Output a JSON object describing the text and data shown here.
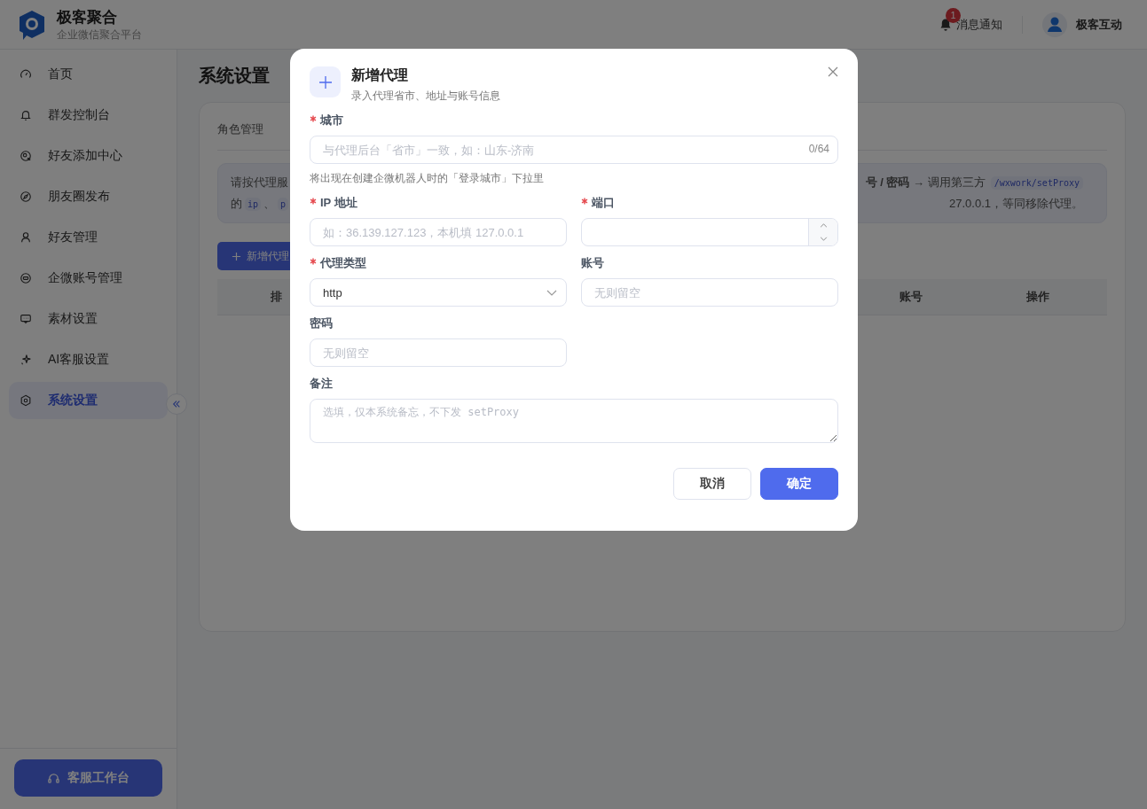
{
  "app": {
    "name": "极客聚合",
    "subtitle": "企业微信聚合平台"
  },
  "header": {
    "notification": {
      "label": "消息通知",
      "badge": "1"
    },
    "user": {
      "name": "极客互动"
    }
  },
  "sidebar": {
    "items": [
      {
        "label": "首页",
        "selected": false
      },
      {
        "label": "群发控制台",
        "selected": false
      },
      {
        "label": "好友添加中心",
        "selected": false
      },
      {
        "label": "朋友圈发布",
        "selected": false
      },
      {
        "label": "好友管理",
        "selected": false
      },
      {
        "label": "企微账号管理",
        "selected": false
      },
      {
        "label": "素材设置",
        "selected": false
      },
      {
        "label": "AI客服设置",
        "selected": false
      },
      {
        "label": "系统设置",
        "selected": true
      }
    ],
    "footer_button": "客服工作台"
  },
  "page": {
    "title": "系统设置",
    "tab": "角色管理",
    "notice": {
      "line_1_left": "请按代理服",
      "line_1_right": "**号 / 密码** → 调用第三方",
      "line_1_code": "/wxwork/setProxy",
      "line_2_left": "的",
      "line_2_codes": [
        "ip",
        "p"
      ],
      "line_2_separator": "、",
      "line_2_right": "27.0.0.1，等同移除代理。"
    },
    "add_button": "新增代理",
    "table": {
      "columns": [
        "排",
        "账号",
        "操作"
      ]
    }
  },
  "dialog": {
    "title": "新增代理",
    "subtitle": "录入代理省市、地址与账号信息",
    "rows": [
      [
        {
          "label": "城市",
          "required": true,
          "kind": "text",
          "placeholder": "与代理后台「省市」一致，如：山东-济南",
          "counter": "0/64",
          "hint": "将出现在创建企微机器人时的「登录城市」下拉里"
        }
      ],
      [
        {
          "label": "IP 地址",
          "required": true,
          "kind": "text",
          "placeholder": "如：36.139.127.123，本机填 127.0.0.1"
        },
        {
          "label": "端口",
          "required": true,
          "kind": "number"
        }
      ],
      [
        {
          "label": "代理类型",
          "required": true,
          "kind": "select",
          "value": "http"
        },
        {
          "label": "账号",
          "required": false,
          "kind": "text",
          "placeholder": "无则留空"
        }
      ],
      [
        {
          "label": "密码",
          "required": false,
          "kind": "text",
          "placeholder": "无则留空"
        }
      ],
      [
        {
          "label": "备注",
          "required": false,
          "kind": "textarea",
          "placeholder": "选填，仅本系统备忘，不下发 setProxy"
        }
      ]
    ],
    "buttons": [
      {
        "label": "取消",
        "kind": "secondary"
      },
      {
        "label": "确定",
        "kind": "primary"
      }
    ]
  }
}
